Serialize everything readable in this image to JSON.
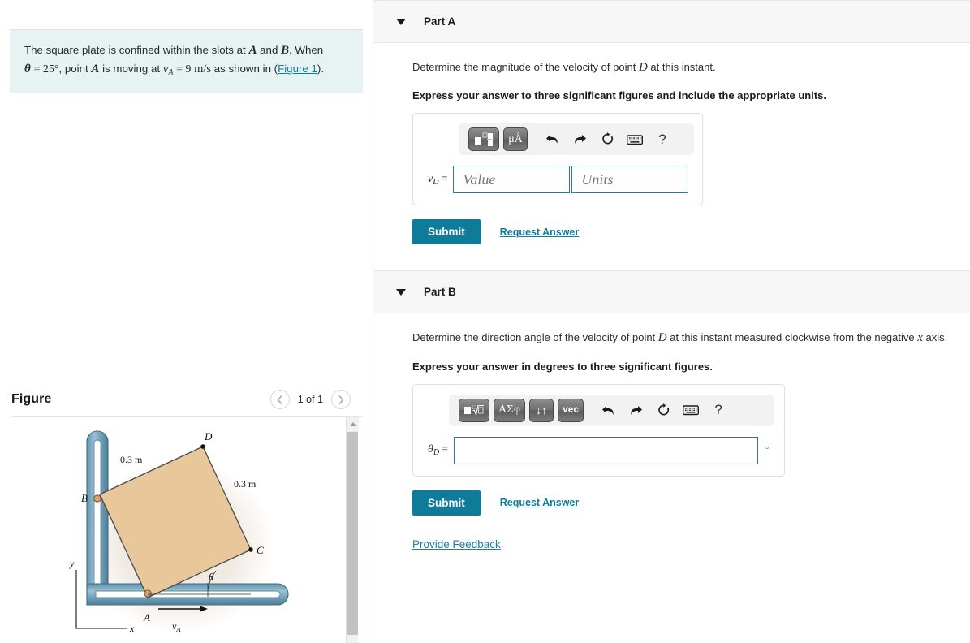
{
  "problem": {
    "line1_pre": "The square plate is confined within the slots at ",
    "var_A": "A",
    "line1_mid": " and ",
    "var_B": "B",
    "line1_post": ". When",
    "theta_symbol": "θ",
    "theta_eq": "= 25°",
    "line2_mid": ", point ",
    "var_A2": "A",
    "line2_mid2": " is moving at ",
    "vA_symbol": "v",
    "vA_sub": "A",
    "vA_eq": "= 9",
    "vA_units": "m/s",
    "line2_post": " as shown in (",
    "figure_link": "Figure 1",
    "line2_end": ")."
  },
  "figure": {
    "title": "Figure",
    "prev_icon": "chevron-left-icon",
    "next_icon": "chevron-right-icon",
    "counter": "1 of 1",
    "diagram": {
      "labels": {
        "D": "D",
        "B": "B",
        "C": "C",
        "A": "A",
        "theta": "θ",
        "vA": "v",
        "vA_sub": "A",
        "x_axis": "x",
        "y_axis": "y",
        "side_top": "0.3 m",
        "side_right": "0.3 m"
      },
      "colors": {
        "plate_fill": "#e8c79a",
        "plate_stroke": "#4a4a4a",
        "track_outer": "#6b9cb5",
        "track_inner": "#ffffff",
        "track_edge": "#3f6d84",
        "pin": "#c8956a"
      }
    }
  },
  "parts": [
    {
      "id": "part-a",
      "title": "Part A",
      "question": "Determine the magnitude of the velocity of point ",
      "question_var": "D",
      "question_tail": " at this instant.",
      "instruction": "Express your answer to three significant figures and include the appropriate units.",
      "toolbar_buttons": [
        {
          "name": "math-template-button",
          "label": ""
        },
        {
          "name": "units-button",
          "label": "μÅ"
        }
      ],
      "tool_icons": [
        {
          "name": "undo-icon",
          "glyph": "↩"
        },
        {
          "name": "redo-icon",
          "glyph": "↪"
        },
        {
          "name": "reset-icon",
          "glyph": "↻"
        },
        {
          "name": "keyboard-icon",
          "glyph": "keyboard"
        },
        {
          "name": "help-icon",
          "glyph": "?"
        }
      ],
      "var_label": "v",
      "var_sub": "D",
      "value_placeholder": "Value",
      "units_placeholder": "Units",
      "value": "",
      "units": "",
      "submit_label": "Submit",
      "request_answer_label": "Request Answer"
    },
    {
      "id": "part-b",
      "title": "Part B",
      "question": "Determine the direction angle of the velocity of point ",
      "question_var": "D",
      "question_tail": " at this instant measured clockwise from the negative ",
      "question_var2": "x",
      "question_tail2": " axis.",
      "instruction": "Express your answer in degrees to three significant figures.",
      "toolbar_buttons": [
        {
          "name": "math-template-button",
          "label": ""
        },
        {
          "name": "greek-letters-button",
          "label": "ΑΣφ"
        },
        {
          "name": "subscript-superscript-button",
          "label": "↓↑"
        },
        {
          "name": "vector-button",
          "label": "vec"
        }
      ],
      "tool_icons": [
        {
          "name": "undo-icon",
          "glyph": "↩"
        },
        {
          "name": "redo-icon",
          "glyph": "↪"
        },
        {
          "name": "reset-icon",
          "glyph": "↻"
        },
        {
          "name": "keyboard-icon",
          "glyph": "keyboard"
        },
        {
          "name": "help-icon",
          "glyph": "?"
        }
      ],
      "var_label": "θ",
      "var_sub": "D",
      "value": "",
      "degree_suffix": "°",
      "submit_label": "Submit",
      "request_answer_label": "Request Answer"
    }
  ],
  "footer": {
    "feedback_label": "Provide Feedback"
  },
  "colors": {
    "accent_teal": "#0e7c99",
    "link_blue": "#1b7fa8",
    "statement_bg": "#e7f3f2",
    "part_header_bg": "#f7f7f7",
    "input_border": "#2a7a93"
  }
}
